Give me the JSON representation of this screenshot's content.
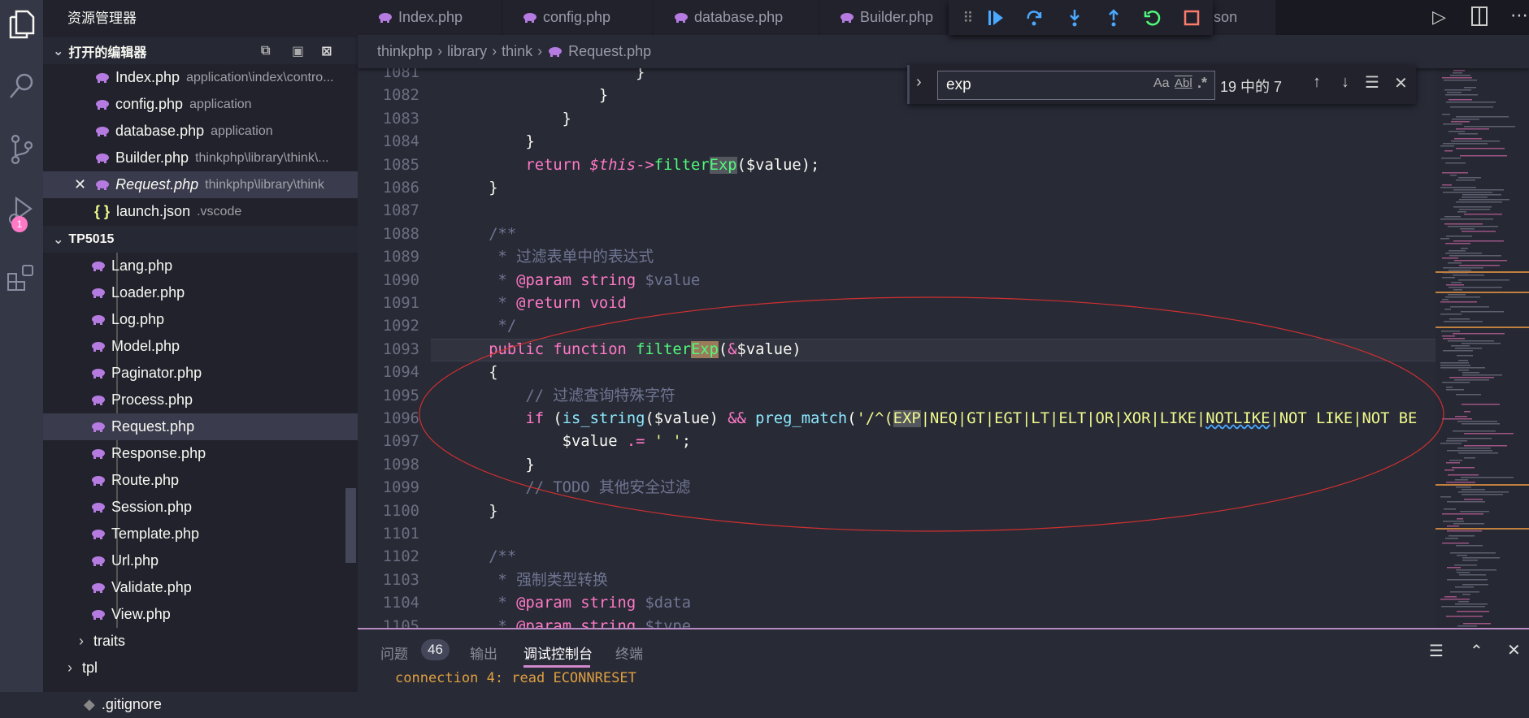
{
  "sidebar": {
    "title": "资源管理器",
    "open_editors": {
      "header": "打开的编辑器",
      "items": [
        {
          "name": "Index.php",
          "path": "application\\index\\contro...",
          "icon": "php-elephant-icon"
        },
        {
          "name": "config.php",
          "path": "application",
          "icon": "php-elephant-icon"
        },
        {
          "name": "database.php",
          "path": "application",
          "icon": "php-elephant-icon"
        },
        {
          "name": "Builder.php",
          "path": "thinkphp\\library\\think\\...",
          "icon": "php-elephant-icon"
        },
        {
          "name": "Request.php",
          "path": "thinkphp\\library\\think",
          "icon": "php-elephant-icon",
          "active": true
        },
        {
          "name": "launch.json",
          "path": ".vscode",
          "icon": "json-braces-icon"
        }
      ]
    },
    "project": {
      "header": "TP5015",
      "files": [
        "Lang.php",
        "Loader.php",
        "Log.php",
        "Model.php",
        "Paginator.php",
        "Process.php",
        "Request.php",
        "Response.php",
        "Route.php",
        "Session.php",
        "Template.php",
        "Url.php",
        "Validate.php",
        "View.php"
      ],
      "selected": "Request.php",
      "folders": [
        "traits",
        "tpl"
      ],
      "partial": ".gitignore"
    }
  },
  "activity": {
    "debug_badge": "1"
  },
  "tabs": [
    "Index.php",
    "config.php",
    "database.php",
    "Builder.php",
    "launch.json"
  ],
  "breadcrumb": [
    "thinkphp",
    "library",
    "think",
    "Request.php"
  ],
  "find": {
    "query": "exp",
    "match_case": "Aa",
    "whole_word": "Abl",
    "regex": ".*",
    "result": "19 中的 7"
  },
  "editor": {
    "current_line": 1093,
    "lines": [
      {
        "n": "1081",
        "t": [
          [
            "                    }",
            "pl"
          ]
        ]
      },
      {
        "n": "1082",
        "t": [
          [
            "                }",
            "pl"
          ]
        ]
      },
      {
        "n": "1083",
        "t": [
          [
            "            }",
            "pl"
          ]
        ]
      },
      {
        "n": "1084",
        "t": [
          [
            "        }",
            "pl"
          ]
        ]
      },
      {
        "n": "1085",
        "t": [
          [
            "        ",
            "pl"
          ],
          [
            "return ",
            "kw"
          ],
          [
            "$this",
            "th"
          ],
          [
            "->",
            "op"
          ],
          [
            "filter",
            "fn"
          ],
          [
            "Exp",
            "fn hl2"
          ],
          [
            "($value);",
            "pl"
          ]
        ]
      },
      {
        "n": "1086",
        "t": [
          [
            "    }",
            "pl"
          ]
        ]
      },
      {
        "n": "1087",
        "t": []
      },
      {
        "n": "1088",
        "t": [
          [
            "    /**",
            "cm"
          ]
        ]
      },
      {
        "n": "1089",
        "t": [
          [
            "     * 过滤表单中的表达式",
            "cm"
          ]
        ]
      },
      {
        "n": "1090",
        "t": [
          [
            "     * ",
            "cm"
          ],
          [
            "@param string",
            "dt"
          ],
          [
            " $value",
            "cm"
          ]
        ]
      },
      {
        "n": "1091",
        "t": [
          [
            "     * ",
            "cm"
          ],
          [
            "@return void",
            "dt"
          ]
        ]
      },
      {
        "n": "1092",
        "t": [
          [
            "     */",
            "cm"
          ]
        ]
      },
      {
        "n": "1093",
        "t": [
          [
            "    ",
            "pl"
          ],
          [
            "public function ",
            "kw"
          ],
          [
            "filter",
            "fn"
          ],
          [
            "Exp",
            "fn hl"
          ],
          [
            "(",
            "pl"
          ],
          [
            "&",
            "op"
          ],
          [
            "$value)",
            "pl"
          ]
        ]
      },
      {
        "n": "1094",
        "t": [
          [
            "    {",
            "pl"
          ]
        ]
      },
      {
        "n": "1095",
        "t": [
          [
            "        // 过滤查询特殊字符",
            "cm"
          ]
        ]
      },
      {
        "n": "1096",
        "t": [
          [
            "        ",
            "pl"
          ],
          [
            "if ",
            "kw"
          ],
          [
            "(",
            "pl"
          ],
          [
            "is_string",
            "cy"
          ],
          [
            "($value) ",
            "pl"
          ],
          [
            "&&",
            "op"
          ],
          [
            " ",
            "pl"
          ],
          [
            "preg_match",
            "cy"
          ],
          [
            "(",
            "pl"
          ],
          [
            "'/^(",
            "st"
          ],
          [
            "EXP",
            "st hl2"
          ],
          [
            "|NEQ|GT|EGT|LT|ELT|OR|XOR|LIKE|",
            "st"
          ],
          [
            "NOTLIKE",
            "st sq"
          ],
          [
            "|NOT LIKE|NOT BE",
            "st"
          ]
        ]
      },
      {
        "n": "1097",
        "t": [
          [
            "            $value ",
            "pl"
          ],
          [
            ".=",
            "op"
          ],
          [
            " ",
            "pl"
          ],
          [
            "' '",
            "st"
          ],
          [
            ";",
            "pl"
          ]
        ]
      },
      {
        "n": "1098",
        "t": [
          [
            "        }",
            "pl"
          ]
        ]
      },
      {
        "n": "1099",
        "t": [
          [
            "        // TODO 其他安全过滤",
            "cm"
          ]
        ]
      },
      {
        "n": "1100",
        "t": [
          [
            "    }",
            "pl"
          ]
        ]
      },
      {
        "n": "1101",
        "t": []
      },
      {
        "n": "1102",
        "t": [
          [
            "    /**",
            "cm"
          ]
        ]
      },
      {
        "n": "1103",
        "t": [
          [
            "     * 强制类型转换",
            "cm"
          ]
        ]
      },
      {
        "n": "1104",
        "t": [
          [
            "     * ",
            "cm"
          ],
          [
            "@param string",
            "dt"
          ],
          [
            " $data",
            "cm"
          ]
        ]
      },
      {
        "n": "1105",
        "t": [
          [
            "     * ",
            "cm"
          ],
          [
            "@param string",
            "dt"
          ],
          [
            " $type",
            "cm"
          ]
        ]
      }
    ]
  },
  "panel": {
    "tabs": [
      {
        "label": "问题",
        "badge": "46"
      },
      {
        "label": "输出"
      },
      {
        "label": "调试控制台",
        "active": true
      },
      {
        "label": "终端"
      }
    ],
    "output": "connection 4: read ECONNRESET"
  },
  "colors": {
    "accent": "#ff79c6",
    "annotation": "#d03030",
    "panel_border": "#b88ac4",
    "output_text": "#e0a040"
  }
}
